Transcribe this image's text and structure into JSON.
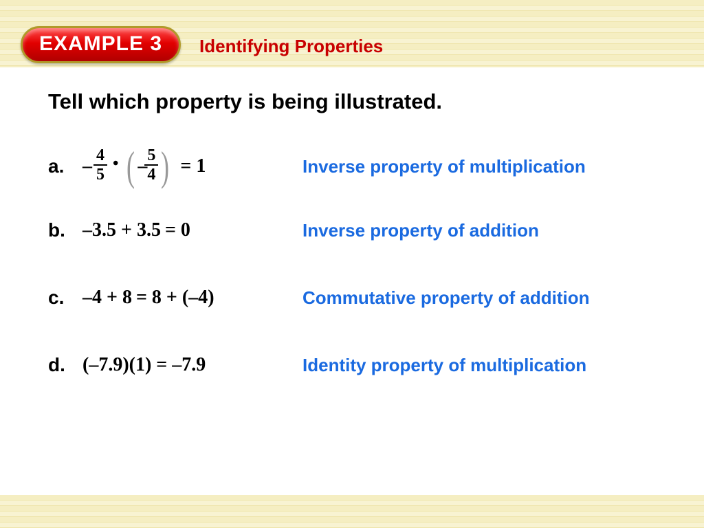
{
  "header": {
    "pill_label": "EXAMPLE 3",
    "title": "Identifying Properties"
  },
  "question": "Tell which property is being illustrated.",
  "items": {
    "a": {
      "letter": "a.",
      "frac1_num": "4",
      "frac1_den": "5",
      "frac2_num": "5",
      "frac2_den": "4",
      "rhs": "= 1",
      "neg": "–",
      "dot": "•",
      "answer": "Inverse property of multiplication"
    },
    "b": {
      "letter": "b.",
      "lhs": "–3.5 + 3.5",
      "rhs": "= 0",
      "answer": "Inverse property of addition"
    },
    "c": {
      "letter": "c.",
      "lhs": "–4 + 8",
      "rhs": "= 8 + (–4)",
      "answer": "Commutative property of addition"
    },
    "d": {
      "letter": "d.",
      "equation": "(–7.9)(1) = –7.9",
      "answer": "Identity property of multiplication"
    }
  }
}
